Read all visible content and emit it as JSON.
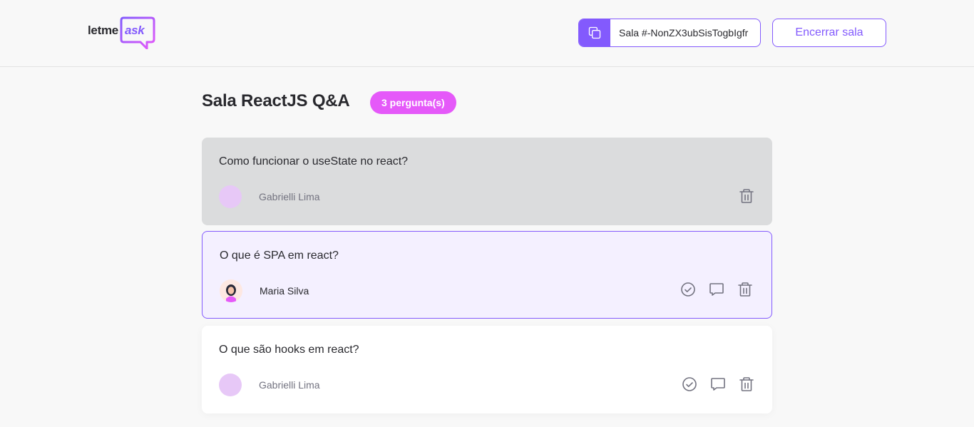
{
  "header": {
    "logo": {
      "word1": "letme",
      "word2": "ask"
    },
    "room_code": {
      "label": "Sala #-NonZX3ubSisTogbIgfr",
      "copy_icon": "copy-icon"
    },
    "close_room_label": "Encerrar sala"
  },
  "room": {
    "title": "Sala ReactJS Q&A",
    "question_count": "3 pergunta(s)"
  },
  "questions": [
    {
      "content": "Como funcionar o useState no react?",
      "author": "Gabrielli Lima",
      "state": "answered",
      "icons": [
        "trash-icon"
      ]
    },
    {
      "content": "O que é SPA em react?",
      "author": "Maria Silva",
      "state": "highlighted",
      "icons": [
        "check-circle-icon",
        "answer-icon",
        "trash-icon"
      ]
    },
    {
      "content": "O que são hooks em react?",
      "author": "Gabrielli Lima",
      "state": "default",
      "icons": [
        "check-circle-icon",
        "answer-icon",
        "trash-icon"
      ]
    }
  ],
  "colors": {
    "brand": "#835afd",
    "badge": "#e559f9",
    "answered_bg": "#dbdcdd",
    "highlighted_bg": "#f4f0ff",
    "icon": "#737380"
  }
}
